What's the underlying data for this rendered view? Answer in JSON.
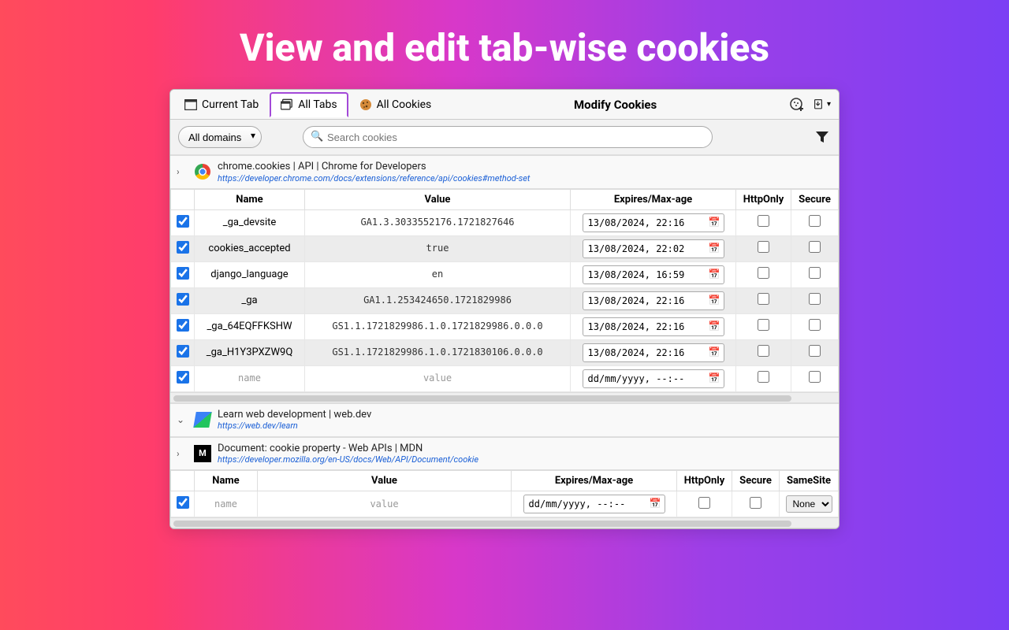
{
  "headline": "View and edit tab-wise cookies",
  "tabs": {
    "current": "Current Tab",
    "all": "All Tabs",
    "cookies": "All Cookies"
  },
  "title": "Modify Cookies",
  "filters": {
    "domain_select": "All domains",
    "search_placeholder": "Search cookies"
  },
  "sections": [
    {
      "expanded": true,
      "favicon": "chrome",
      "title": "chrome.cookies | API | Chrome for Developers",
      "url": "https://developer.chrome.com/docs/extensions/reference/api/cookies#method-set",
      "columns": [
        "Name",
        "Value",
        "Expires/Max-age",
        "HttpOnly",
        "Secure"
      ],
      "rows": [
        {
          "checked": true,
          "name": "_ga_devsite",
          "value": "GA1.3.3033552176.1721827646",
          "expires": "13/08/2024, 22:16",
          "httpOnly": false,
          "secure": false
        },
        {
          "checked": true,
          "name": "cookies_accepted",
          "value": "true",
          "expires": "13/08/2024, 22:02",
          "httpOnly": false,
          "secure": false
        },
        {
          "checked": true,
          "name": "django_language",
          "value": "en",
          "expires": "13/08/2024, 16:59",
          "httpOnly": false,
          "secure": false
        },
        {
          "checked": true,
          "name": "_ga",
          "value": "GA1.1.253424650.1721829986",
          "expires": "13/08/2024, 22:16",
          "httpOnly": false,
          "secure": false
        },
        {
          "checked": true,
          "name": "_ga_64EQFFKSHW",
          "value": "GS1.1.1721829986.1.0.1721829986.0.0.0",
          "expires": "13/08/2024, 22:16",
          "httpOnly": false,
          "secure": false
        },
        {
          "checked": true,
          "name": "_ga_H1Y3PXZW9Q",
          "value": "GS1.1.1721829986.1.0.1721830106.0.0.0",
          "expires": "13/08/2024, 22:16",
          "httpOnly": false,
          "secure": false
        }
      ],
      "placeholder_row": {
        "checked": true,
        "name": "name",
        "value": "value",
        "expires": "dd/mm/yyyy, --:--"
      }
    },
    {
      "expanded": false,
      "favicon": "webdev",
      "title": "Learn web development | web.dev",
      "url": "https://web.dev/learn"
    },
    {
      "expanded": true,
      "favicon": "mdn",
      "favicon_text": "M",
      "title": "Document: cookie property - Web APIs | MDN",
      "url": "https://developer.mozilla.org/en-US/docs/Web/API/Document/cookie",
      "columns": [
        "Name",
        "Value",
        "Expires/Max-age",
        "HttpOnly",
        "Secure",
        "SameSite"
      ],
      "placeholder_row": {
        "checked": true,
        "name": "name",
        "value": "value",
        "expires": "dd/mm/yyyy, --:--",
        "samesite": "None"
      }
    }
  ]
}
